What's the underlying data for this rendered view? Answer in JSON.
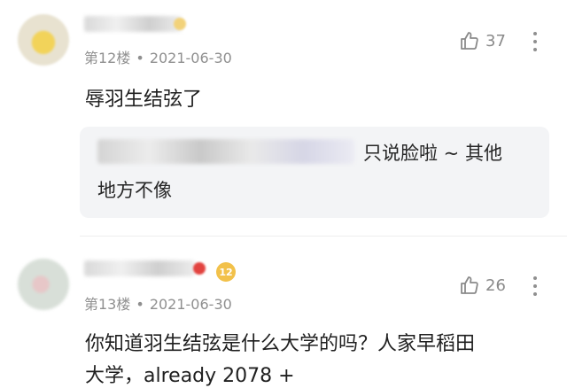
{
  "comments": [
    {
      "floor": "第12楼",
      "dot": "•",
      "date": "2021-06-30",
      "likes": "37",
      "text": "辱羽生结弦了",
      "quote": {
        "line1": "只说脸啦 ~ 其他",
        "line2": "地方不像"
      }
    },
    {
      "floor": "第13楼",
      "dot": "•",
      "date": "2021-06-30",
      "likes": "26",
      "level": "12",
      "line1": "你知道羽生结弦是什么大学的吗？人家早稻田",
      "line2": "大学，already 2078 +"
    }
  ],
  "colors": {
    "meta": "#8f8f8f",
    "quote_bg": "#f3f4f6",
    "level_badge": "#f2c14a"
  }
}
